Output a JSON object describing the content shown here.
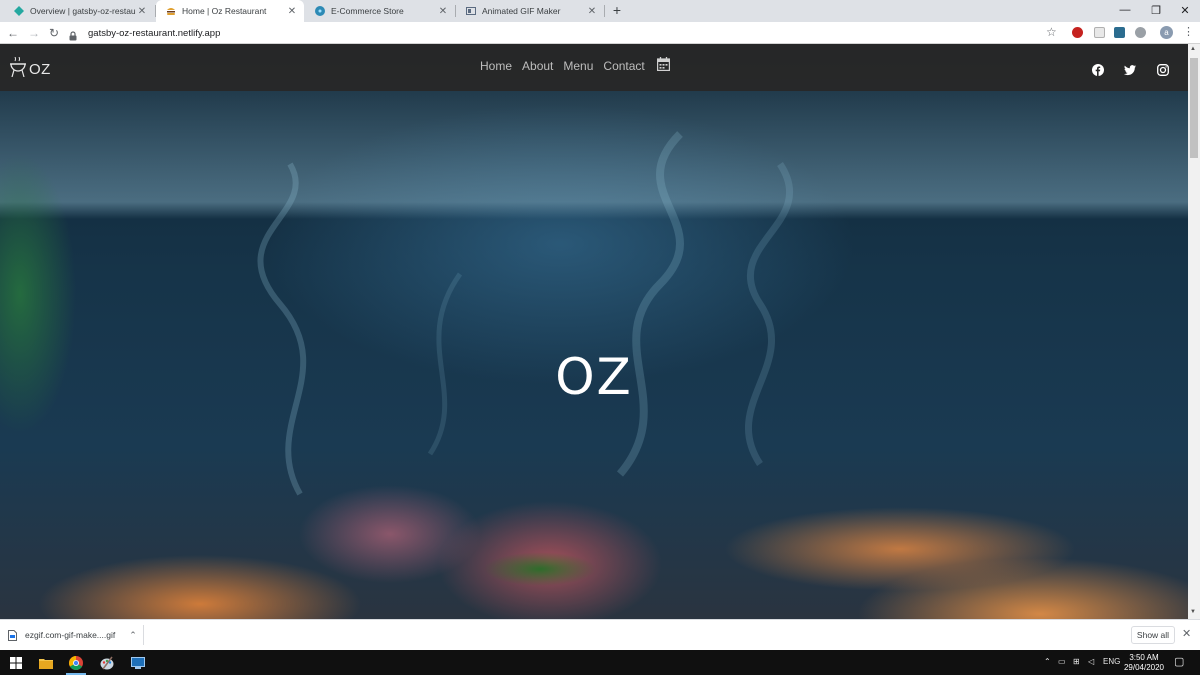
{
  "browser": {
    "tabs": [
      {
        "title": "Overview | gatsby-oz-restaurant",
        "favicon": "netlify-diamond-icon",
        "active": false
      },
      {
        "title": "Home | Oz Restaurant",
        "favicon": "burger-icon",
        "active": true
      },
      {
        "title": "E-Commerce Store",
        "favicon": "react-icon",
        "active": false
      },
      {
        "title": "Animated GIF Maker",
        "favicon": "gif-maker-icon",
        "active": false
      }
    ],
    "new_tab_label": "+",
    "url": "gatsby-oz-restaurant.netlify.app",
    "profile_initial": "a"
  },
  "site": {
    "brand": "OZ",
    "nav": [
      "Home",
      "About",
      "Menu",
      "Contact"
    ],
    "social": [
      "facebook-icon",
      "twitter-icon",
      "instagram-icon"
    ],
    "hero_title": "OZ"
  },
  "download_shelf": {
    "file_name": "ezgif.com-gif-make....gif",
    "show_all_label": "Show all"
  },
  "taskbar": {
    "language": "ENG",
    "time": "3:50 AM",
    "date": "29/04/2020"
  },
  "colors": {
    "header_bg": "#282828",
    "nav_text": "#bdbdbd",
    "hero_text": "#ffffff",
    "taskbar_bg": "#101010"
  }
}
